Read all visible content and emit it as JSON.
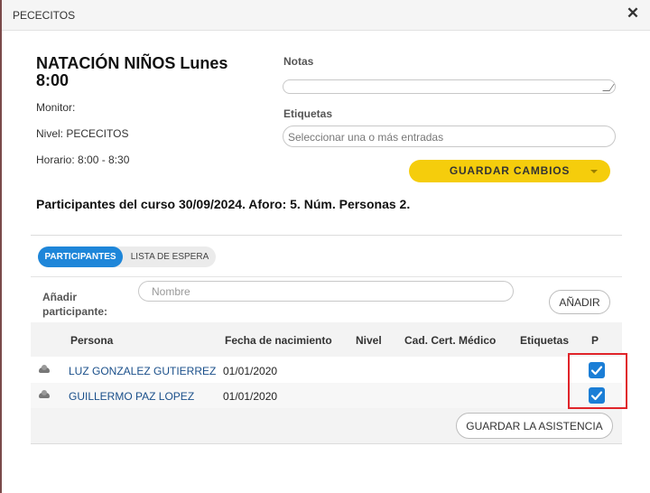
{
  "window": {
    "title": "PECECITOS"
  },
  "course": {
    "title": "NATACIÓN NIÑOS Lunes 8:00",
    "monitor": "Monitor:",
    "nivel": "Nivel: PECECITOS",
    "horario": "Horario: 8:00 - 8:30"
  },
  "form": {
    "notes_label": "Notas",
    "notes_value": "",
    "tags_label": "Etiquetas",
    "tags_placeholder": "Seleccionar una o más entradas",
    "save_label": "GUARDAR CAMBIOS"
  },
  "summary": "Participantes del curso 30/09/2024. Aforo: 5. Núm. Personas 2.",
  "tabs": [
    {
      "label": "PARTICIPANTES",
      "active": true
    },
    {
      "label": "LISTA DE ESPERA",
      "active": false
    }
  ],
  "add": {
    "label": "Añadir participante:",
    "placeholder": "Nombre",
    "button": "AÑADIR"
  },
  "table": {
    "headers": [
      "Persona",
      "Fecha de nacimiento",
      "Nivel",
      "Cad. Cert. Médico",
      "Etiquetas",
      "P"
    ],
    "rows": [
      {
        "persona": "LUZ GONZALEZ GUTIERREZ",
        "fecha": "01/01/2020",
        "nivel": "",
        "cert": "",
        "etiquetas": "",
        "present": true
      },
      {
        "persona": "GUILLERMO PAZ LOPEZ",
        "fecha": "01/01/2020",
        "nivel": "",
        "cert": "",
        "etiquetas": "",
        "present": true
      }
    ]
  },
  "attendance_button": "GUARDAR LA ASISTENCIA",
  "colors": {
    "accent": "#1e86d9",
    "save": "#f5cd0c",
    "highlight": "#e0242a"
  }
}
